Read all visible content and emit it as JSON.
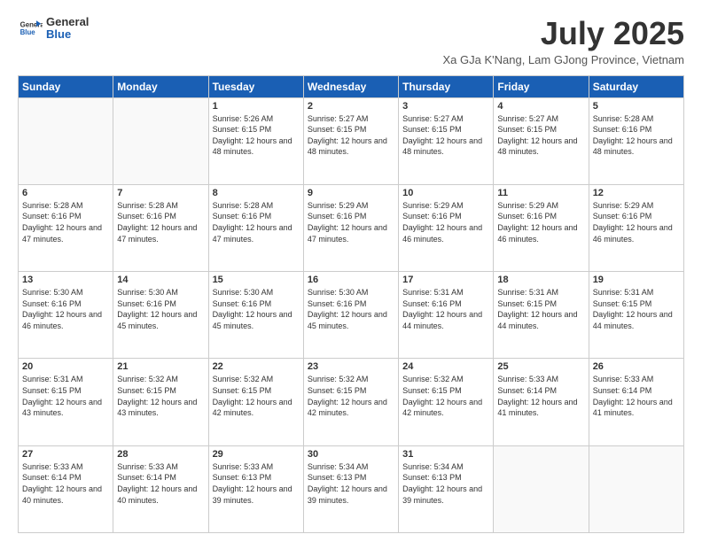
{
  "logo": {
    "line1": "General",
    "line2": "Blue"
  },
  "title": "July 2025",
  "subtitle": "Xa GJa K'Nang, Lam GJong Province, Vietnam",
  "days_of_week": [
    "Sunday",
    "Monday",
    "Tuesday",
    "Wednesday",
    "Thursday",
    "Friday",
    "Saturday"
  ],
  "weeks": [
    [
      {
        "day": "",
        "info": ""
      },
      {
        "day": "",
        "info": ""
      },
      {
        "day": "1",
        "info": "Sunrise: 5:26 AM\nSunset: 6:15 PM\nDaylight: 12 hours and 48 minutes."
      },
      {
        "day": "2",
        "info": "Sunrise: 5:27 AM\nSunset: 6:15 PM\nDaylight: 12 hours and 48 minutes."
      },
      {
        "day": "3",
        "info": "Sunrise: 5:27 AM\nSunset: 6:15 PM\nDaylight: 12 hours and 48 minutes."
      },
      {
        "day": "4",
        "info": "Sunrise: 5:27 AM\nSunset: 6:15 PM\nDaylight: 12 hours and 48 minutes."
      },
      {
        "day": "5",
        "info": "Sunrise: 5:28 AM\nSunset: 6:16 PM\nDaylight: 12 hours and 48 minutes."
      }
    ],
    [
      {
        "day": "6",
        "info": "Sunrise: 5:28 AM\nSunset: 6:16 PM\nDaylight: 12 hours and 47 minutes."
      },
      {
        "day": "7",
        "info": "Sunrise: 5:28 AM\nSunset: 6:16 PM\nDaylight: 12 hours and 47 minutes."
      },
      {
        "day": "8",
        "info": "Sunrise: 5:28 AM\nSunset: 6:16 PM\nDaylight: 12 hours and 47 minutes."
      },
      {
        "day": "9",
        "info": "Sunrise: 5:29 AM\nSunset: 6:16 PM\nDaylight: 12 hours and 47 minutes."
      },
      {
        "day": "10",
        "info": "Sunrise: 5:29 AM\nSunset: 6:16 PM\nDaylight: 12 hours and 46 minutes."
      },
      {
        "day": "11",
        "info": "Sunrise: 5:29 AM\nSunset: 6:16 PM\nDaylight: 12 hours and 46 minutes."
      },
      {
        "day": "12",
        "info": "Sunrise: 5:29 AM\nSunset: 6:16 PM\nDaylight: 12 hours and 46 minutes."
      }
    ],
    [
      {
        "day": "13",
        "info": "Sunrise: 5:30 AM\nSunset: 6:16 PM\nDaylight: 12 hours and 46 minutes."
      },
      {
        "day": "14",
        "info": "Sunrise: 5:30 AM\nSunset: 6:16 PM\nDaylight: 12 hours and 45 minutes."
      },
      {
        "day": "15",
        "info": "Sunrise: 5:30 AM\nSunset: 6:16 PM\nDaylight: 12 hours and 45 minutes."
      },
      {
        "day": "16",
        "info": "Sunrise: 5:30 AM\nSunset: 6:16 PM\nDaylight: 12 hours and 45 minutes."
      },
      {
        "day": "17",
        "info": "Sunrise: 5:31 AM\nSunset: 6:16 PM\nDaylight: 12 hours and 44 minutes."
      },
      {
        "day": "18",
        "info": "Sunrise: 5:31 AM\nSunset: 6:15 PM\nDaylight: 12 hours and 44 minutes."
      },
      {
        "day": "19",
        "info": "Sunrise: 5:31 AM\nSunset: 6:15 PM\nDaylight: 12 hours and 44 minutes."
      }
    ],
    [
      {
        "day": "20",
        "info": "Sunrise: 5:31 AM\nSunset: 6:15 PM\nDaylight: 12 hours and 43 minutes."
      },
      {
        "day": "21",
        "info": "Sunrise: 5:32 AM\nSunset: 6:15 PM\nDaylight: 12 hours and 43 minutes."
      },
      {
        "day": "22",
        "info": "Sunrise: 5:32 AM\nSunset: 6:15 PM\nDaylight: 12 hours and 42 minutes."
      },
      {
        "day": "23",
        "info": "Sunrise: 5:32 AM\nSunset: 6:15 PM\nDaylight: 12 hours and 42 minutes."
      },
      {
        "day": "24",
        "info": "Sunrise: 5:32 AM\nSunset: 6:15 PM\nDaylight: 12 hours and 42 minutes."
      },
      {
        "day": "25",
        "info": "Sunrise: 5:33 AM\nSunset: 6:14 PM\nDaylight: 12 hours and 41 minutes."
      },
      {
        "day": "26",
        "info": "Sunrise: 5:33 AM\nSunset: 6:14 PM\nDaylight: 12 hours and 41 minutes."
      }
    ],
    [
      {
        "day": "27",
        "info": "Sunrise: 5:33 AM\nSunset: 6:14 PM\nDaylight: 12 hours and 40 minutes."
      },
      {
        "day": "28",
        "info": "Sunrise: 5:33 AM\nSunset: 6:14 PM\nDaylight: 12 hours and 40 minutes."
      },
      {
        "day": "29",
        "info": "Sunrise: 5:33 AM\nSunset: 6:13 PM\nDaylight: 12 hours and 39 minutes."
      },
      {
        "day": "30",
        "info": "Sunrise: 5:34 AM\nSunset: 6:13 PM\nDaylight: 12 hours and 39 minutes."
      },
      {
        "day": "31",
        "info": "Sunrise: 5:34 AM\nSunset: 6:13 PM\nDaylight: 12 hours and 39 minutes."
      },
      {
        "day": "",
        "info": ""
      },
      {
        "day": "",
        "info": ""
      }
    ]
  ]
}
